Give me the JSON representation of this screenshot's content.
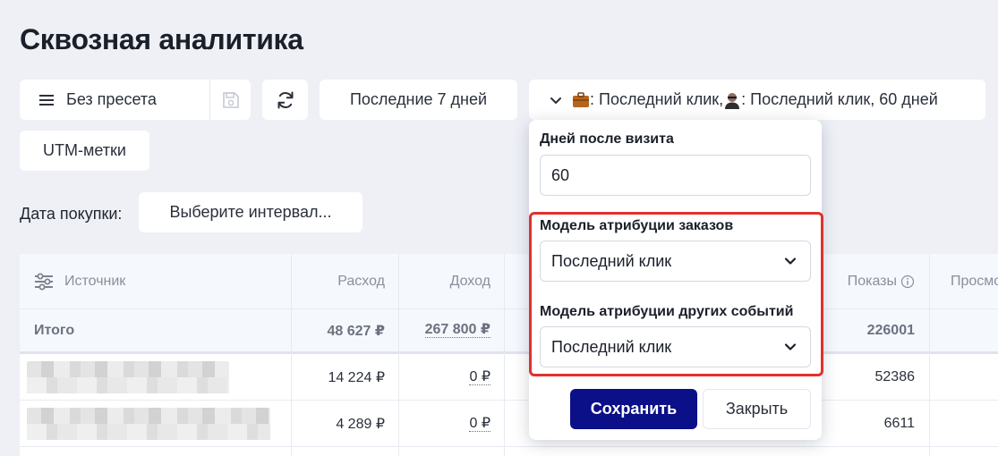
{
  "page": {
    "title": "Сквозная аналитика"
  },
  "toolbar": {
    "preset_label": "Без пресета",
    "period_label": "Последние 7 дней",
    "attribution": {
      "part1": ": Последний клик, ",
      "part2": ": Последний клик, 60 дней"
    },
    "utm_label": "UTM-метки"
  },
  "filters": {
    "purchase_date_label": "Дата покупки:",
    "interval_placeholder": "Выберите интервал..."
  },
  "table": {
    "headers": {
      "source": "Источник",
      "expense": "Расход",
      "income": "Доход",
      "impressions": "Показы",
      "views": "Просмо"
    },
    "totals": {
      "label": "Итого",
      "expense": "48 627 ₽",
      "income": "267 800 ₽",
      "impressions": "226001"
    },
    "rows": [
      {
        "expense": "14 224 ₽",
        "income": "0 ₽",
        "impressions": "52386"
      },
      {
        "expense": "4 289 ₽",
        "income": "0 ₽",
        "impressions": "6611"
      }
    ]
  },
  "popup": {
    "days_label": "Дней после визита",
    "days_value": "60",
    "orders_model_label": "Модель атрибуции заказов",
    "orders_model_value": "Последний клик",
    "events_model_label": "Модель атрибуции других событий",
    "events_model_value": "Последний клик",
    "save_label": "Сохранить",
    "close_label": "Закрыть"
  },
  "colors": {
    "primary": "#0b0f88",
    "highlight": "#e0312f",
    "background": "#eef0f6"
  }
}
